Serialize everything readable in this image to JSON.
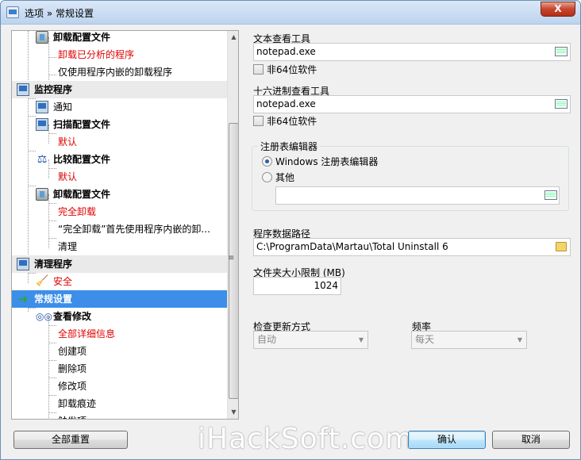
{
  "window": {
    "title": "选项 » 常规设置",
    "close_label": "X"
  },
  "tree": {
    "rows": [
      {
        "label": "卸载配置文件",
        "style": "bold",
        "icon": "trash-icon"
      },
      {
        "label": "卸载已分析的程序",
        "style": "red"
      },
      {
        "label": "仅使用程序内嵌的卸载程序",
        "style": "normal"
      },
      {
        "label": "监控程序",
        "style": "head",
        "icon": "monitor-icon"
      },
      {
        "label": "通知",
        "style": "normal",
        "icon": "monitor-icon"
      },
      {
        "label": "扫描配置文件",
        "style": "bold",
        "icon": "monitor-icon"
      },
      {
        "label": "默认",
        "style": "red"
      },
      {
        "label": "比较配置文件",
        "style": "bold",
        "icon": "scale-icon"
      },
      {
        "label": "默认",
        "style": "red"
      },
      {
        "label": "卸载配置文件",
        "style": "bold",
        "icon": "trash-icon"
      },
      {
        "label": "完全卸载",
        "style": "red"
      },
      {
        "label": "“完全卸载”首先使用程序内嵌的卸...",
        "style": "normal"
      },
      {
        "label": "清理",
        "style": "normal"
      },
      {
        "label": "清理程序",
        "style": "head",
        "icon": "monitor-icon"
      },
      {
        "label": "安全",
        "style": "red",
        "icon": "broom-icon"
      },
      {
        "label": "常规设置",
        "style": "head-selected",
        "icon": "green-arrow-icon"
      },
      {
        "label": "查看修改",
        "style": "bold",
        "icon": "glasses-icon"
      },
      {
        "label": "全部详细信息",
        "style": "red"
      },
      {
        "label": "创建项",
        "style": "normal"
      },
      {
        "label": "删除项",
        "style": "normal"
      },
      {
        "label": "修改项",
        "style": "normal"
      },
      {
        "label": "卸载痕迹",
        "style": "normal"
      },
      {
        "label": "触发项",
        "style": "normal"
      }
    ]
  },
  "text_viewer": {
    "label": "文本查看工具",
    "value": "notepad.exe",
    "checkbox_label": "非64位软件"
  },
  "hex_viewer": {
    "label": "十六进制查看工具",
    "value": "notepad.exe",
    "checkbox_label": "非64位软件"
  },
  "registry_editor": {
    "group_title": "注册表编辑器",
    "option_windows": "Windows 注册表编辑器",
    "option_other": "其他",
    "other_value": ""
  },
  "data_path": {
    "label": "程序数据路径",
    "value": "C:\\ProgramData\\Martau\\Total Uninstall 6"
  },
  "folder_size": {
    "label": "文件夹大小限制 (MB)",
    "value": "1024"
  },
  "update_check": {
    "label": "检查更新方式",
    "value": "自动"
  },
  "frequency": {
    "label": "频率",
    "value": "每天"
  },
  "buttons": {
    "reset_all": "全部重置",
    "ok": "确认",
    "cancel": "取消"
  },
  "watermark": "iHackSoft.com"
}
